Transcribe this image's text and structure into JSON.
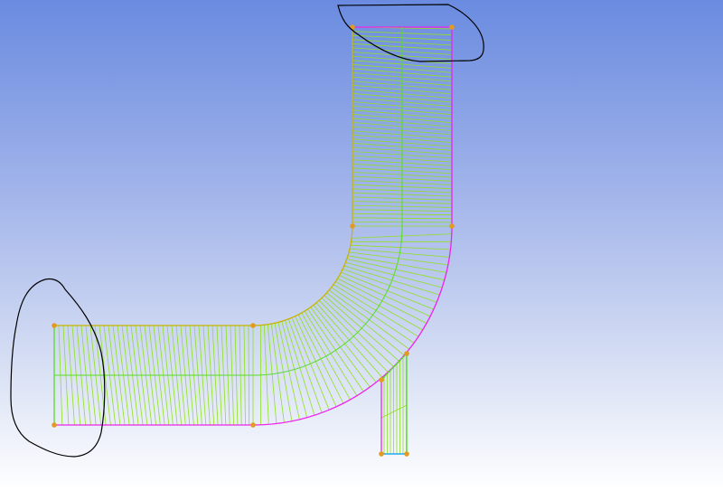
{
  "viewport": {
    "background_top": "#6a8be0",
    "background_bottom": "#ffffff"
  },
  "mesh": {
    "element_line_color": "#90e020",
    "interior_edge_color": "#55dd22",
    "outer_wall_color": "#ee22ee",
    "inner_wall_color": "#c8b400",
    "branch_outlet_color": "#22aaee",
    "vertex_color": "#e39a20",
    "sketch_stroke_color": "#000000"
  }
}
